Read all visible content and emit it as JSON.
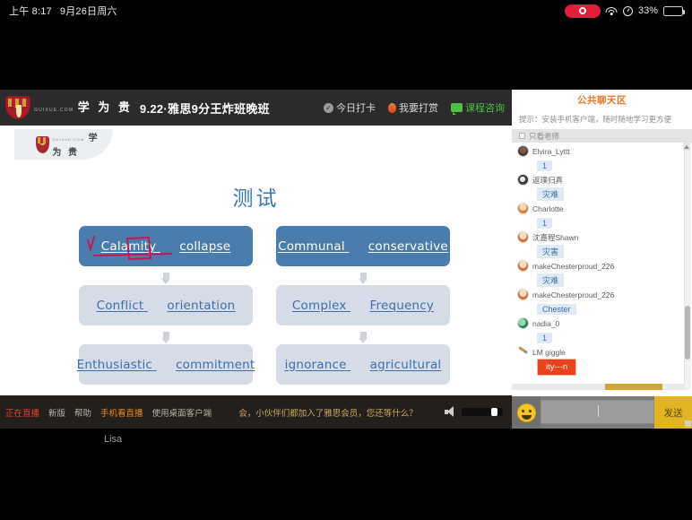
{
  "statusbar": {
    "time": "上午 8:17",
    "date": "9月26日周六",
    "recording_icon": "record-icon",
    "wifi_icon": "wifi-icon",
    "lock_rotation_icon": "rotation-lock-icon",
    "battery_percent": "33%",
    "battery_level": 33,
    "accent_record": "#e0203a"
  },
  "header": {
    "logo_sub": "GUIXUE.COM",
    "logo_main": "学 为 贵",
    "title": "9.22·雅思9分王炸班晚班",
    "actions": [
      {
        "label": "今日打卡",
        "icon": "check-circle-icon",
        "color": "#d8d8d8"
      },
      {
        "label": "我要打赏",
        "icon": "coin-icon",
        "color": "#d8d8d8"
      },
      {
        "label": "课程咨询",
        "icon": "chat-bubble-icon",
        "color": "#4fbf45"
      }
    ]
  },
  "slide": {
    "watermark_sub": "GUIXUE.COM",
    "watermark_main": "学 为 贵",
    "title": "测试",
    "title_color": "#3b76b5",
    "columns": [
      {
        "nodes": [
          {
            "style": "dark",
            "word_a": "Calamity",
            "word_b": "collapse",
            "annotated": true
          },
          {
            "style": "light",
            "word_a": "Conflict",
            "word_b": "orientation",
            "annotated": false
          },
          {
            "style": "light",
            "word_a": "Enthusiastic",
            "word_b": "commitment",
            "annotated": false
          }
        ]
      },
      {
        "nodes": [
          {
            "style": "dark",
            "word_a": "Communal",
            "word_b": "conservative",
            "annotated": false
          },
          {
            "style": "light",
            "word_a": "Complex",
            "word_b": "Frequency",
            "annotated": false
          },
          {
            "style": "light",
            "word_a": "ignorance",
            "word_b": "agricultural",
            "annotated": false
          }
        ]
      }
    ],
    "annotation_color": "#c2185b"
  },
  "playerbar": {
    "live_label": "正在直播",
    "links": [
      {
        "label": "新版",
        "color": "#b9b2a8"
      },
      {
        "label": "帮助",
        "color": "#b9b2a8"
      },
      {
        "label": "手机看直播",
        "color": "#e98b22"
      },
      {
        "label": "使用桌面客户端",
        "color": "#b9b2a8"
      }
    ],
    "marquee": "会，小伙伴们都加入了雅思会员，您还等什么？",
    "volume_icon": "speaker-icon",
    "volume_percent": 88
  },
  "chat": {
    "title": "公共聊天区",
    "title_color": "#e8782f",
    "hint": "提示：安装手机客户端，随时随地学习更方便",
    "filter_label": "只看老师",
    "messages": [
      {
        "avatar": "a1",
        "name": "Elvira_Lyttt",
        "text": "1",
        "highlight": false
      },
      {
        "avatar": "a2",
        "name": "返璞归真",
        "text": "灾难",
        "highlight": false
      },
      {
        "avatar": "a3",
        "name": "Charlotte",
        "text": "1",
        "highlight": false
      },
      {
        "avatar": "a4",
        "name": "沈嘉程Shawn",
        "text": "灾害",
        "highlight": false
      },
      {
        "avatar": "a4",
        "name": "makeChesterproud_226",
        "text": "灾难",
        "highlight": false
      },
      {
        "avatar": "a4",
        "name": "makeChesterproud_226",
        "text": "Chester",
        "highlight": false
      },
      {
        "avatar": "a5",
        "name": "nadia_0",
        "text": "1",
        "highlight": false
      },
      {
        "avatar": "pen",
        "name": "LM giggle",
        "text": "ity---n",
        "highlight": true
      }
    ],
    "input_placeholder": "",
    "input_value": "",
    "emoji_icon": "smiley-icon",
    "send_label": "发送",
    "send_color": "#e2b422"
  },
  "bottom": {
    "presenter_name": "Lisa"
  }
}
